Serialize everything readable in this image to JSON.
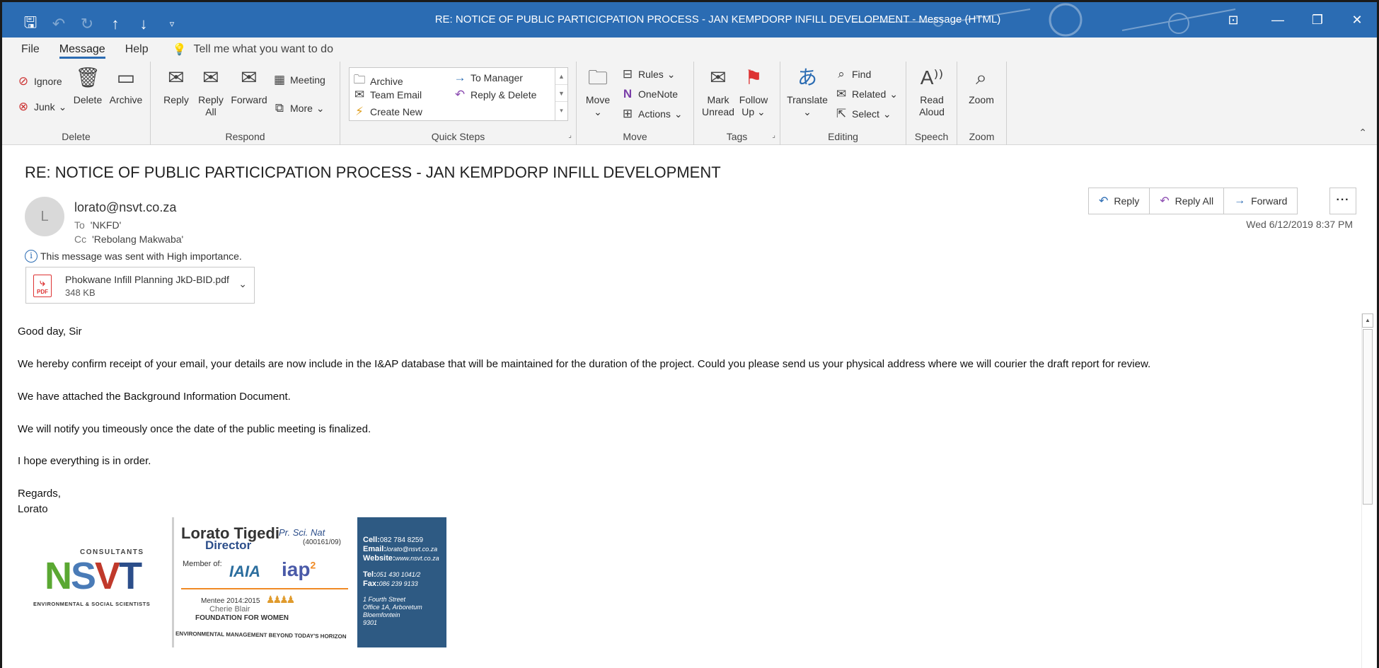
{
  "window": {
    "title": "RE: NOTICE OF PUBLIC PARTICICPATION PROCESS - JAN KEMPDORP INFILL DEVELOPMENT  -  Message (HTML)"
  },
  "menu": {
    "tabs": [
      "File",
      "Message",
      "Help"
    ],
    "active_tab": "Message",
    "tell_me": "Tell me what you want to do"
  },
  "ribbon": {
    "delete": {
      "label": "Delete",
      "ignore": "Ignore",
      "junk": "Junk",
      "delete": "Delete",
      "archive": "Archive"
    },
    "respond": {
      "label": "Respond",
      "reply": "Reply",
      "reply_all_1": "Reply",
      "reply_all_2": "All",
      "forward": "Forward",
      "meeting": "Meeting",
      "more": "More"
    },
    "quick_steps": {
      "label": "Quick Steps",
      "archive": "Archive",
      "team_email": "Team Email",
      "create_new": "Create New",
      "to_manager": "To Manager",
      "reply_delete": "Reply & Delete"
    },
    "move": {
      "label": "Move",
      "move": "Move",
      "rules": "Rules",
      "onenote": "OneNote",
      "actions": "Actions"
    },
    "tags": {
      "label": "Tags",
      "mark_1": "Mark",
      "mark_2": "Unread",
      "follow_1": "Follow",
      "follow_2": "Up"
    },
    "editing": {
      "label": "Editing",
      "translate": "Translate",
      "find": "Find",
      "related": "Related",
      "select": "Select"
    },
    "speech": {
      "label": "Speech",
      "read_1": "Read",
      "read_2": "Aloud"
    },
    "zoom": {
      "label": "Zoom",
      "zoom": "Zoom"
    }
  },
  "message": {
    "subject": "RE: NOTICE OF PUBLIC PARTICICPATION PROCESS - JAN KEMPDORP INFILL DEVELOPMENT",
    "avatar_initial": "L",
    "sender": "lorato@nsvt.co.za",
    "to_label": "To",
    "to": "'NKFD'",
    "cc_label": "Cc",
    "cc": "'Rebolang Makwaba'",
    "importance": "This message was sent with High importance.",
    "attachment": {
      "name": "Phokwane Infill Planning JkD-BID.pdf",
      "size": "348 KB",
      "badge": "PDF"
    },
    "actions": {
      "reply": "Reply",
      "reply_all": "Reply All",
      "forward": "Forward",
      "more": "···"
    },
    "datetime": "Wed 6/12/2019 8:37 PM"
  },
  "body": {
    "greeting": "Good day, Sir",
    "p1": "We hereby confirm receipt of your email, your details are now include in the I&AP database that will be maintained for the duration of the project. Could you please send us your physical address where we will courier the draft report for review.",
    "p2": "We have attached the Background Information Document.",
    "p3": "We will notify you timeously once the date of the public meeting is finalized.",
    "p4": "I hope everything is in order.",
    "regards": "Regards,",
    "name": "Lorato"
  },
  "signature": {
    "consultants": "CONSULTANTS",
    "logo_letters": [
      "N",
      "S",
      "V",
      "T"
    ],
    "logo_sub": "ENVIRONMENTAL & SOCIAL SCIENTISTS",
    "name": "Lorato Tigedi",
    "credential": "Pr. Sci. Nat",
    "reg": "(400161/09)",
    "title": "Director",
    "member_of": "Member of:",
    "iaia": "IAIA",
    "iap": "iap",
    "iap_sup": "2",
    "mentee": "Mentee 2014:2015",
    "cherie": "Cherie Blair",
    "foundation": "FOUNDATION FOR WOMEN",
    "motto": "ENVIRONMENTAL MANAGEMENT BEYOND TODAY'S HORIZON",
    "cell_label": "Cell:",
    "cell": "082 784 8259",
    "email_label": "Email:",
    "email": "lorato@nsvt.co.za",
    "website_label": "Website:",
    "website": "www.nsvt.co.za",
    "tel_label": "Tel:",
    "tel": "051 430 1041/2",
    "fax_label": "Fax:",
    "fax": "086 239 9133",
    "addr1": "1 Fourth Street",
    "addr2": "Office 1A, Arboretum",
    "addr3": "Bloemfontein",
    "addr4": "9301"
  }
}
